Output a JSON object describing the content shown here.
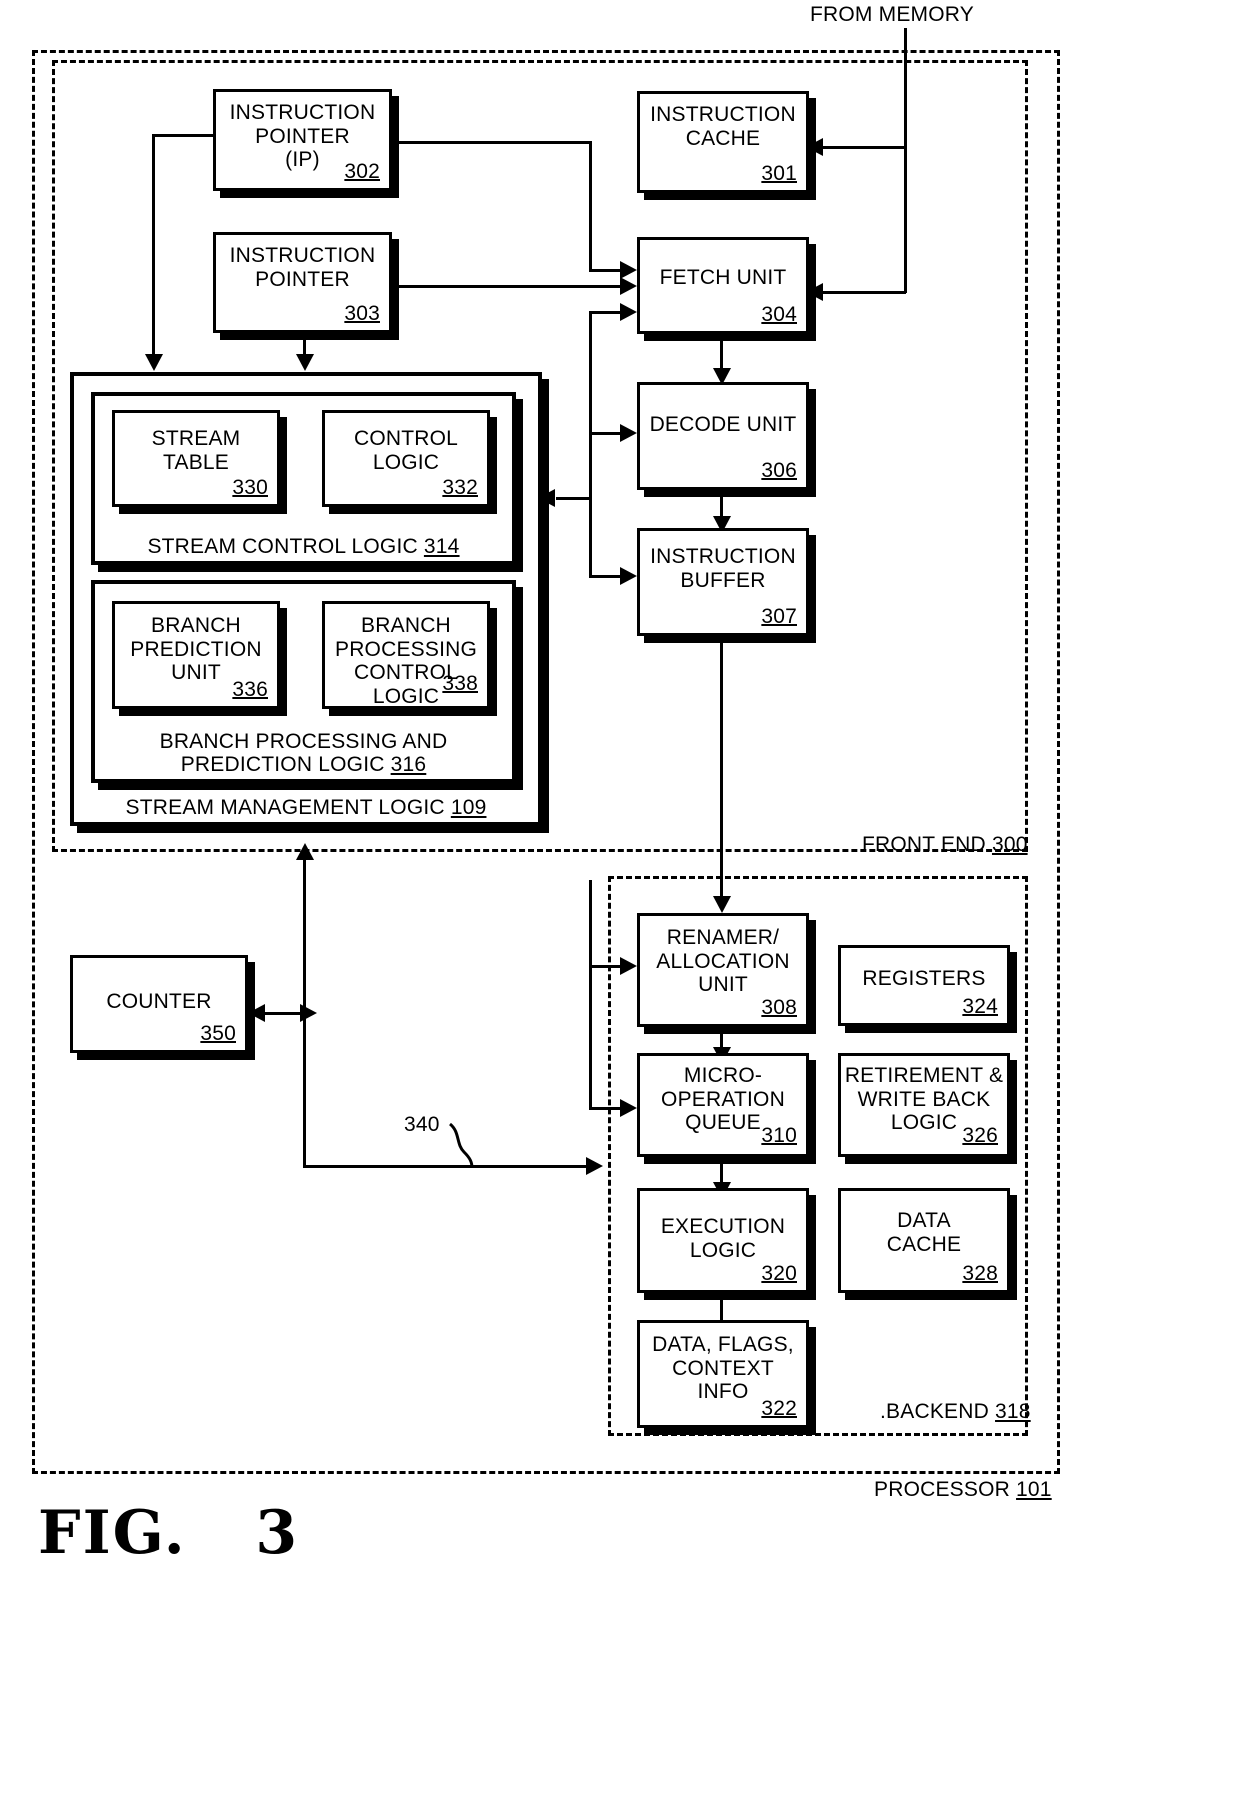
{
  "figure": {
    "label": "FIG.",
    "number": "3"
  },
  "annotations": {
    "from_memory": "FROM MEMORY",
    "ref_340": "340"
  },
  "regions": {
    "processor": {
      "name": "PROCESSOR",
      "ref": "101"
    },
    "front_end": {
      "name": "FRONT END",
      "ref": "300"
    },
    "backend": {
      "name": "BACKEND",
      "ref": "318"
    }
  },
  "groups": {
    "stream_management": {
      "caption": "STREAM MANAGEMENT LOGIC",
      "ref": "109"
    },
    "stream_control": {
      "caption": "STREAM CONTROL LOGIC",
      "ref": "314"
    },
    "branch_processing": {
      "caption_line1": "BRANCH PROCESSING AND",
      "caption_line2": "PREDICTION LOGIC",
      "ref": "316"
    }
  },
  "blocks": [
    {
      "id": "instruction_pointer_ip",
      "lines": [
        "INSTRUCTION",
        "POINTER",
        "(IP)"
      ],
      "ref": "302"
    },
    {
      "id": "instruction_pointer",
      "lines": [
        "INSTRUCTION",
        "POINTER"
      ],
      "ref": "303"
    },
    {
      "id": "instruction_cache",
      "lines": [
        "INSTRUCTION",
        "CACHE"
      ],
      "ref": "301"
    },
    {
      "id": "fetch_unit",
      "lines": [
        "FETCH UNIT"
      ],
      "ref": "304"
    },
    {
      "id": "decode_unit",
      "lines": [
        "DECODE UNIT"
      ],
      "ref": "306"
    },
    {
      "id": "instruction_buffer",
      "lines": [
        "INSTRUCTION",
        "BUFFER"
      ],
      "ref": "307"
    },
    {
      "id": "stream_table",
      "lines": [
        "STREAM",
        "TABLE"
      ],
      "ref": "330"
    },
    {
      "id": "control_logic",
      "lines": [
        "CONTROL",
        "LOGIC"
      ],
      "ref": "332"
    },
    {
      "id": "branch_prediction_unit",
      "lines": [
        "BRANCH",
        "PREDICTION",
        "UNIT"
      ],
      "ref": "336"
    },
    {
      "id": "branch_processing_control_logic",
      "lines": [
        "BRANCH",
        "PROCESSING",
        "CONTROL",
        "LOGIC"
      ],
      "ref": "338"
    },
    {
      "id": "counter",
      "lines": [
        "COUNTER"
      ],
      "ref": "350"
    },
    {
      "id": "renamer_allocation_unit",
      "lines": [
        "RENAMER/",
        "ALLOCATION",
        "UNIT"
      ],
      "ref": "308"
    },
    {
      "id": "registers",
      "lines": [
        "REGISTERS"
      ],
      "ref": "324"
    },
    {
      "id": "micro_operation_queue",
      "lines": [
        "MICRO-",
        "OPERATION",
        "QUEUE"
      ],
      "ref": "310"
    },
    {
      "id": "retirement_write_back_logic",
      "lines": [
        "RETIREMENT &",
        "WRITE BACK",
        "LOGIC"
      ],
      "ref": "326"
    },
    {
      "id": "execution_logic",
      "lines": [
        "EXECUTION",
        "LOGIC"
      ],
      "ref": "320"
    },
    {
      "id": "data_cache",
      "lines": [
        "DATA",
        "CACHE"
      ],
      "ref": "328"
    },
    {
      "id": "data_flags_context_info",
      "lines": [
        "DATA, FLAGS,",
        "CONTEXT",
        "INFO"
      ],
      "ref": "322"
    }
  ]
}
